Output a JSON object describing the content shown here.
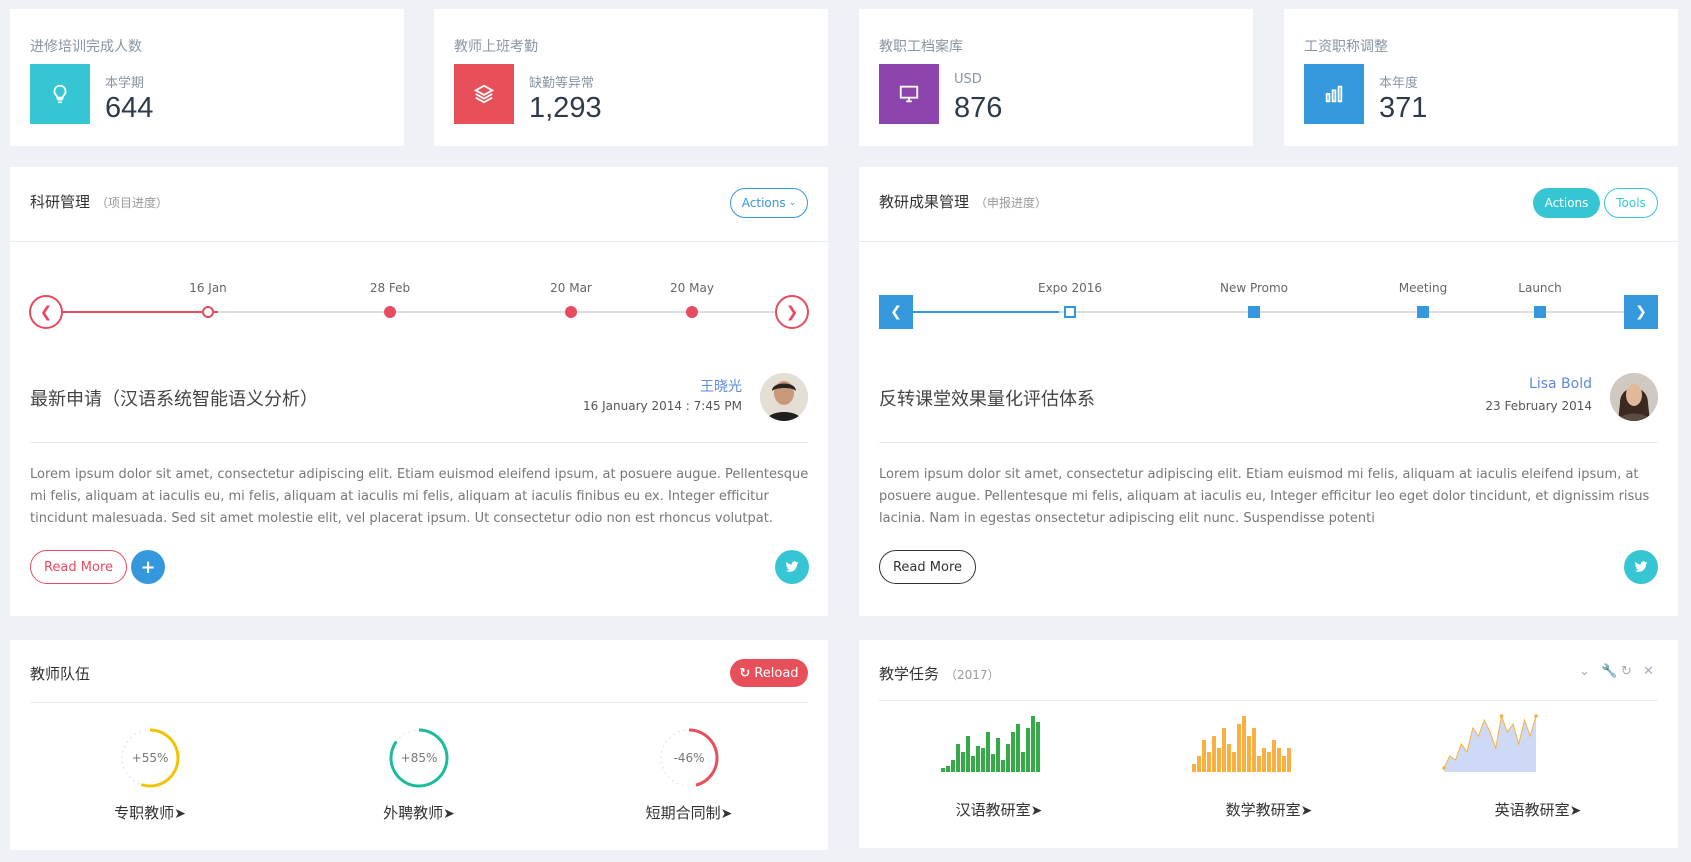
{
  "stats": [
    {
      "title": "进修培训完成人数",
      "label": "本学期",
      "value": "644",
      "icon": "lightbulb-icon",
      "color": "#36c6d3"
    },
    {
      "title": "教师上班考勤",
      "label": "缺勤等异常",
      "value": "1,293",
      "icon": "layers-icon",
      "color": "#e7505a"
    },
    {
      "title": "教职工档案库",
      "label": "USD",
      "value": "876",
      "icon": "monitor-icon",
      "color": "#8e44ad"
    },
    {
      "title": "工资职称调整",
      "label": "本年度",
      "value": "371",
      "icon": "bar-chart-icon",
      "color": "#3598dc"
    }
  ],
  "research": {
    "title": "科研管理",
    "subtitle": "（项目进度）",
    "actions_label": "Actions",
    "timeline": [
      "16 Jan",
      "28 Feb",
      "20 Mar",
      "20 May"
    ],
    "event_title": "最新申请（汉语系统智能语义分析）",
    "author": "王晓光",
    "time": "16 January 2014 : 7:45 PM",
    "body": "Lorem ipsum dolor sit amet, consectetur adipiscing elit. Etiam euismod eleifend ipsum, at posuere augue. Pellentesque mi felis, aliquam at iaculis eu, mi felis, aliquam at iaculis mi felis, aliquam at iaculis finibus eu ex. Integer efficitur tincidunt malesuada. Sed sit amet molestie elit, vel placerat ipsum. Ut consectetur odio non est rhoncus volutpat.",
    "read_more": "Read More"
  },
  "results": {
    "title": "教研成果管理",
    "subtitle": "（申报进度）",
    "actions_label": "Actions",
    "tools_label": "Tools",
    "timeline": [
      "Expo 2016",
      "New Promo",
      "Meeting",
      "Launch"
    ],
    "event_title": "反转课堂效果量化评估体系",
    "author": "Lisa Bold",
    "time": "23 February 2014",
    "body": "Lorem ipsum dolor sit amet, consectetur adipiscing elit. Etiam euismod mi felis, aliquam at iaculis eleifend ipsum, at posuere augue. Pellentesque mi felis, aliquam at iaculis eu, Integer efficitur leo eget dolor tincidunt, et dignissim risus lacinia. Nam in egestas onsectetur adipiscing elit nunc. Suspendisse potenti",
    "read_more": "Read More"
  },
  "teachers": {
    "title": "教师队伍",
    "reload_label": "Reload",
    "gauges": [
      {
        "label": "专职教师",
        "value": "+55%",
        "percent": 55,
        "color": "#f3c200"
      },
      {
        "label": "外聘教师",
        "value": "+85%",
        "percent": 85,
        "color": "#1bbc9b"
      },
      {
        "label": "短期合同制",
        "value": "-46%",
        "percent": 46,
        "color": "#e7505a"
      }
    ]
  },
  "tasks": {
    "title": "教学任务",
    "subtitle": "（2017）",
    "sparks": [
      {
        "label": "汉语教研室",
        "type": "bar",
        "color": "#35aa47",
        "values": [
          2,
          3,
          6,
          14,
          10,
          18,
          8,
          13,
          12,
          20,
          9,
          17,
          6,
          14,
          20,
          24,
          10,
          22,
          28,
          25
        ]
      },
      {
        "label": "数学教研室",
        "type": "bar",
        "color": "#f9b040",
        "values": [
          4,
          8,
          16,
          10,
          18,
          12,
          22,
          14,
          10,
          24,
          28,
          18,
          22,
          8,
          12,
          10,
          16,
          12,
          8,
          12
        ]
      },
      {
        "label": "英语教研室",
        "type": "line",
        "color": "#f9b040",
        "values": [
          2,
          8,
          6,
          14,
          10,
          22,
          18,
          26,
          20,
          12,
          28,
          20,
          24,
          14,
          26,
          18,
          28
        ]
      }
    ]
  }
}
